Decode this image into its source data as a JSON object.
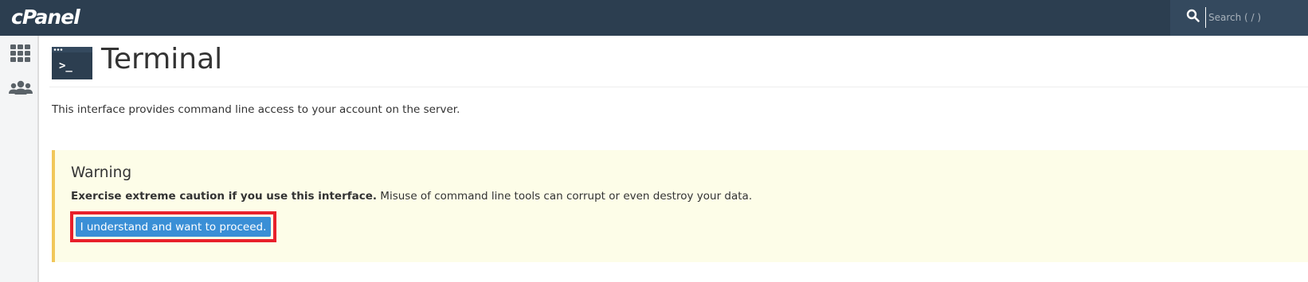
{
  "header": {
    "logo": "cPanel",
    "search": {
      "placeholder": "Search ( / )",
      "value": ""
    }
  },
  "sidebar": {
    "items": [
      {
        "name": "tools",
        "icon": "grid-icon"
      },
      {
        "name": "users",
        "icon": "users-icon"
      }
    ]
  },
  "page": {
    "title": "Terminal",
    "icon": "terminal-icon",
    "terminal_prompt": ">_",
    "description": "This interface provides command line access to your account on the server."
  },
  "warning": {
    "title": "Warning",
    "bold_text": "Exercise extreme caution if you use this interface.",
    "text": " Misuse of command line tools can corrupt or even destroy your data.",
    "button_label": "I understand and want to proceed."
  },
  "colors": {
    "header_bg": "#2c3e50",
    "search_bg": "#34495e",
    "button_bg": "#3a8fd6",
    "highlight_border": "#e8202b",
    "warning_bg": "#fdfde8",
    "warning_accent": "#f1c75a"
  }
}
